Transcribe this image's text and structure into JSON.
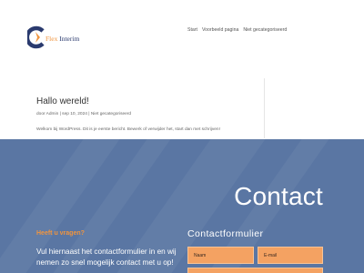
{
  "brand": {
    "logo_part1": "Flex",
    "logo_part2": " Interim",
    "colors": {
      "primary": "#2a3a6e",
      "accent": "#f0953f",
      "section_bg": "#5a76a3"
    }
  },
  "nav": {
    "items": [
      "Start",
      "Voorbeeld pagina",
      "Niet gecategoriseerd"
    ]
  },
  "post": {
    "title": "Hallo wereld!",
    "meta": "door Admin | sep 10, 2024 | Niet gecategoriseerd",
    "body": "Welkom bij WordPress. Dit is je eerste bericht. Bewerk of verwijder het, start dan met schrijven!"
  },
  "contact": {
    "heading": "Contact",
    "questions_title": "Heeft u vragen?",
    "questions_body": "Vul hiernaast het contactformulier in en wij nemen zo snel mogelijk contact met u op!",
    "form_title": "Contactformulier",
    "name_placeholder": "Naam",
    "email_placeholder": "E-mail"
  }
}
